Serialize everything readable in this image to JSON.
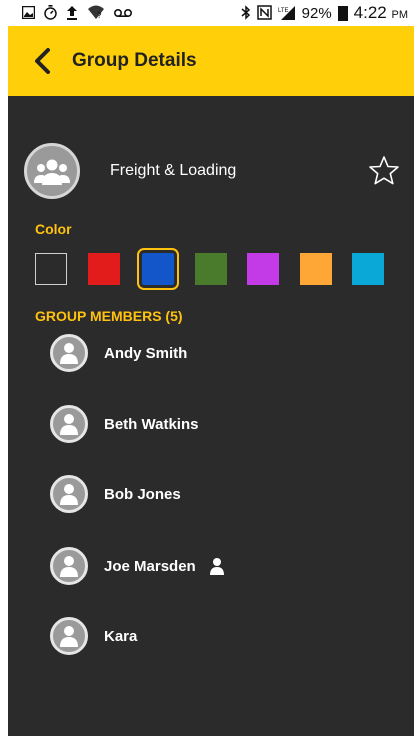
{
  "status_bar": {
    "battery": "92%",
    "time": "4:22",
    "ampm": "PM",
    "icons": [
      "image-icon",
      "stopwatch-icon",
      "upload-icon",
      "wifi-question-icon",
      "voicemail-icon",
      "bluetooth-icon",
      "nfc-icon",
      "lte-signal-icon",
      "battery-icon"
    ]
  },
  "app_bar": {
    "title": "Group Details",
    "back_icon": "back-chevron-icon",
    "background": "#ffcf0a"
  },
  "group": {
    "name": "Freight & Loading",
    "favorite": false
  },
  "color_section": {
    "label": "Color",
    "accent": "#ffc20e",
    "swatches": [
      {
        "color": "none",
        "selected": false
      },
      {
        "color": "#e21b1b",
        "selected": false
      },
      {
        "color": "#1256c9",
        "selected": true
      },
      {
        "color": "#4a7a2c",
        "selected": false
      },
      {
        "color": "#c23be6",
        "selected": false
      },
      {
        "color": "#ffa736",
        "selected": false
      },
      {
        "color": "#0aa8d6",
        "selected": false
      }
    ]
  },
  "members_section": {
    "label": "GROUP MEMBERS (5)",
    "members": [
      {
        "name": "Andy Smith",
        "is_admin": false
      },
      {
        "name": "Beth Watkins",
        "is_admin": false
      },
      {
        "name": "Bob Jones",
        "is_admin": false
      },
      {
        "name": "Joe Marsden",
        "is_admin": true
      },
      {
        "name": "Kara",
        "is_admin": false
      }
    ]
  }
}
